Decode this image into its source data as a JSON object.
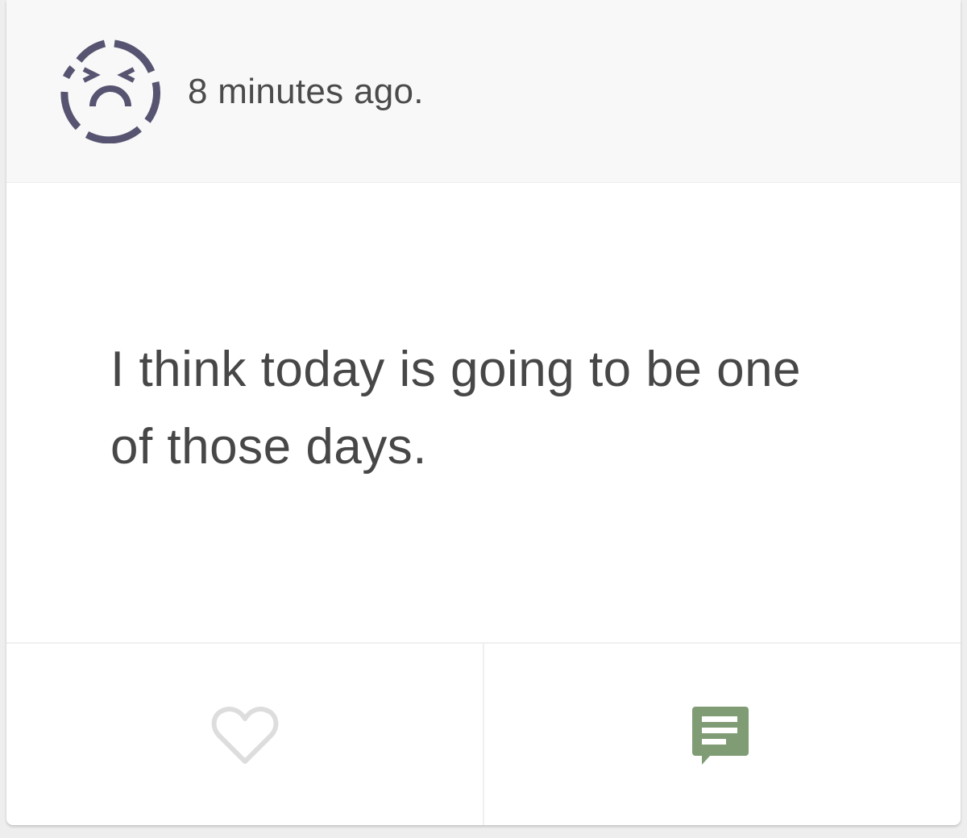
{
  "post": {
    "mood_icon": "disappointed-face-icon",
    "timestamp": "8 minutes ago.",
    "text": "I think today is going to be one of those days."
  },
  "actions": {
    "like_icon": "heart-outline-icon",
    "comment_icon": "comment-icon"
  },
  "colors": {
    "mood_icon": "#565470",
    "heart_outline": "#dddddd",
    "comment_accent": "#7f9c74",
    "text": "#474747"
  }
}
